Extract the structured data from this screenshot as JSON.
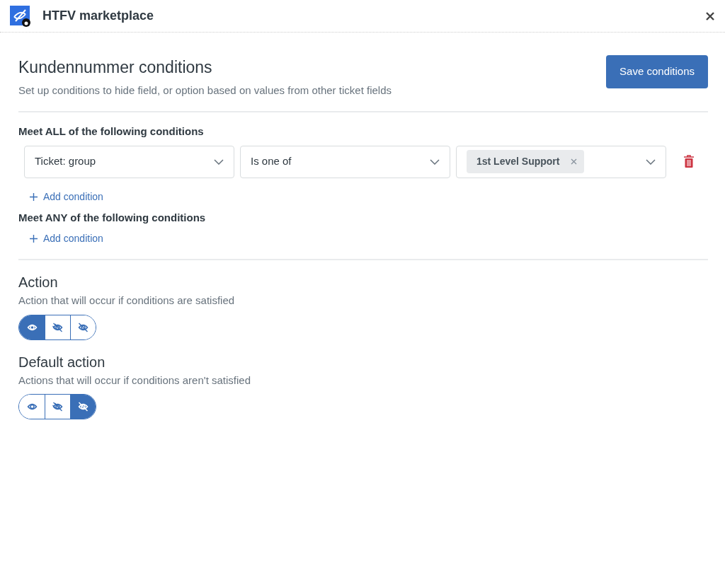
{
  "window": {
    "title": "HTFV marketplace"
  },
  "header": {
    "title": "Kundennummer conditions",
    "subtitle": "Set up conditions to hide field, or option based on values from other ticket fields",
    "save_button": "Save conditions"
  },
  "all_conditions": {
    "heading": "Meet ALL of the following conditions",
    "rows": [
      {
        "field": "Ticket: group",
        "operator": "Is one of",
        "values": [
          "1st Level Support"
        ]
      }
    ],
    "add_label": "Add condition"
  },
  "any_conditions": {
    "heading": "Meet ANY of the following conditions",
    "add_label": "Add condition"
  },
  "actions": [
    {
      "title": "Action",
      "description": "Action that will occur if conditions are satisfied",
      "options": [
        {
          "kind": "eye",
          "selected": true
        },
        {
          "kind": "eye-hatched",
          "selected": false
        },
        {
          "kind": "eye-slash",
          "selected": false
        }
      ]
    },
    {
      "title": "Default action",
      "description": "Actions that will occur if conditions aren't satisfied",
      "options": [
        {
          "kind": "eye",
          "selected": false
        },
        {
          "kind": "eye-hatched",
          "selected": false
        },
        {
          "kind": "eye-slash",
          "selected": true
        }
      ]
    }
  ]
}
